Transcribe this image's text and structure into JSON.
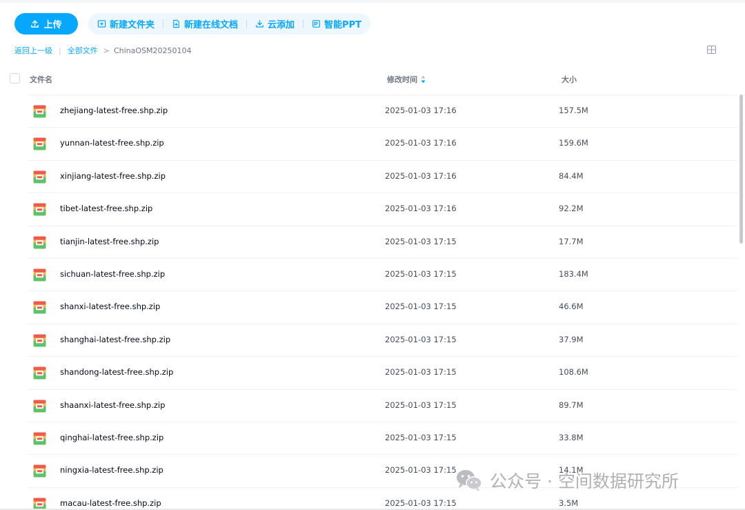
{
  "toolbar": {
    "upload_label": "上传",
    "actions": [
      {
        "label": "新建文件夹",
        "icon": "folder-plus-icon"
      },
      {
        "label": "新建在线文档",
        "icon": "document-plus-icon"
      },
      {
        "label": "云添加",
        "icon": "cloud-download-icon"
      },
      {
        "label": "智能PPT",
        "icon": "ppt-icon"
      }
    ]
  },
  "breadcrumb": {
    "back": "返回上一级",
    "all": "全部文件",
    "current": "ChinaOSM20250104"
  },
  "table": {
    "columns": {
      "name": "文件名",
      "time": "修改时间",
      "size": "大小"
    },
    "rows": [
      {
        "name": "zhejiang-latest-free.shp.zip",
        "time": "2025-01-03 17:16",
        "size": "157.5M"
      },
      {
        "name": "yunnan-latest-free.shp.zip",
        "time": "2025-01-03 17:16",
        "size": "159.6M"
      },
      {
        "name": "xinjiang-latest-free.shp.zip",
        "time": "2025-01-03 17:16",
        "size": "84.4M"
      },
      {
        "name": "tibet-latest-free.shp.zip",
        "time": "2025-01-03 17:16",
        "size": "92.2M"
      },
      {
        "name": "tianjin-latest-free.shp.zip",
        "time": "2025-01-03 17:15",
        "size": "17.7M"
      },
      {
        "name": "sichuan-latest-free.shp.zip",
        "time": "2025-01-03 17:15",
        "size": "183.4M"
      },
      {
        "name": "shanxi-latest-free.shp.zip",
        "time": "2025-01-03 17:15",
        "size": "46.6M"
      },
      {
        "name": "shanghai-latest-free.shp.zip",
        "time": "2025-01-03 17:15",
        "size": "37.9M"
      },
      {
        "name": "shandong-latest-free.shp.zip",
        "time": "2025-01-03 17:15",
        "size": "108.6M"
      },
      {
        "name": "shaanxi-latest-free.shp.zip",
        "time": "2025-01-03 17:15",
        "size": "89.7M"
      },
      {
        "name": "qinghai-latest-free.shp.zip",
        "time": "2025-01-03 17:15",
        "size": "33.8M"
      },
      {
        "name": "ningxia-latest-free.shp.zip",
        "time": "2025-01-03 17:15",
        "size": "14.1M"
      },
      {
        "name": "macau-latest-free.shp.zip",
        "time": "2025-01-03 17:15",
        "size": "3.5M"
      }
    ]
  },
  "watermark": {
    "text": "公众号 · 空间数据研究所"
  },
  "colors": {
    "accent": "#06a7ff",
    "accent_bg": "#eef6fe",
    "text": "#03081a",
    "muted": "#6e7585"
  }
}
